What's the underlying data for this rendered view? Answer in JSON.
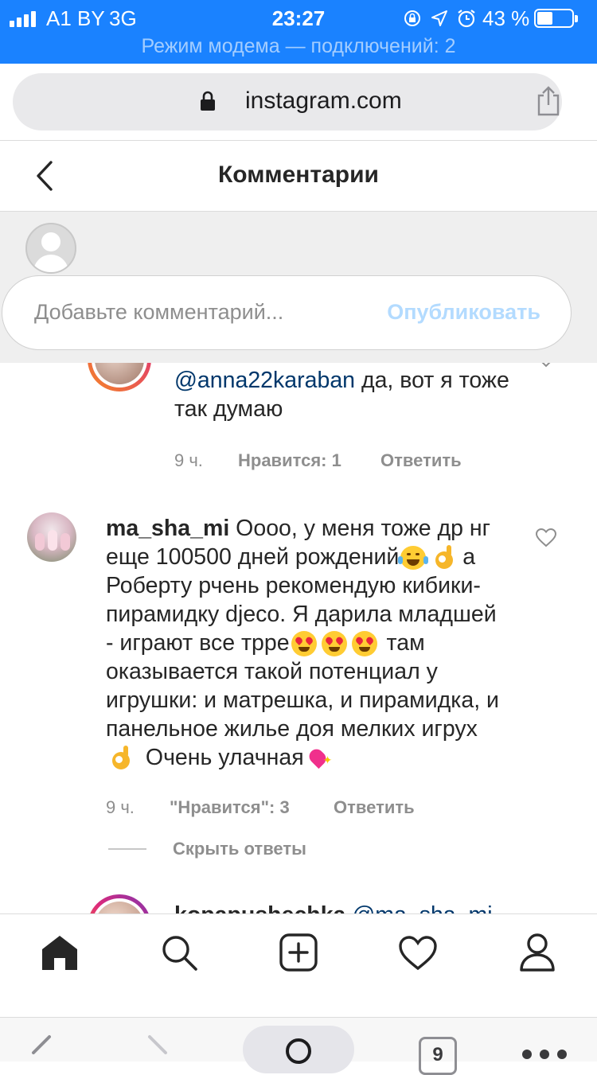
{
  "status_bar": {
    "carrier": "A1 BY",
    "network": "3G",
    "time": "23:27",
    "battery_percent": "43 %",
    "hotspot": "Режим модема — подключений: 2"
  },
  "browser": {
    "url": "instagram.com",
    "tab_count": "9"
  },
  "header": {
    "title": "Комментарии"
  },
  "composer": {
    "placeholder": "Добавьте комментарий...",
    "publish_label": "Опубликовать"
  },
  "comments": [
    {
      "mention": "@anna22karaban",
      "text_line1": " да, вот я тоже",
      "text_line2": "так думаю",
      "time": "9 ч.",
      "likes": "Нравится: 1",
      "reply": "Ответить"
    },
    {
      "username": "ma_sha_mi",
      "lines": [
        " Оооо, у меня тоже др нг",
        "еще 100500 дней рождений",
        " а",
        "Роберту рчень рекомендую кибики-",
        "пирамидку djeco. Я дарила младшей",
        "- играют все трре",
        " там",
        "оказывается такой потенциал у",
        "игрушки: и матрешка, и пирамидка, и",
        "панельное жилье доя мелких игрух",
        " Очень улачная"
      ],
      "time": "9 ч.",
      "likes": "\"Нравится\": 3",
      "reply": "Ответить",
      "hide_replies": "Скрыть ответы"
    },
    {
      "username": "kopapushechka",
      "mention": "@ma_sha_mi"
    }
  ],
  "colors": {
    "status_bar_bg": "#1a82ff",
    "publish_disabled": "#b3dbff",
    "mention": "#00376b",
    "meta": "#8e8e8e"
  }
}
